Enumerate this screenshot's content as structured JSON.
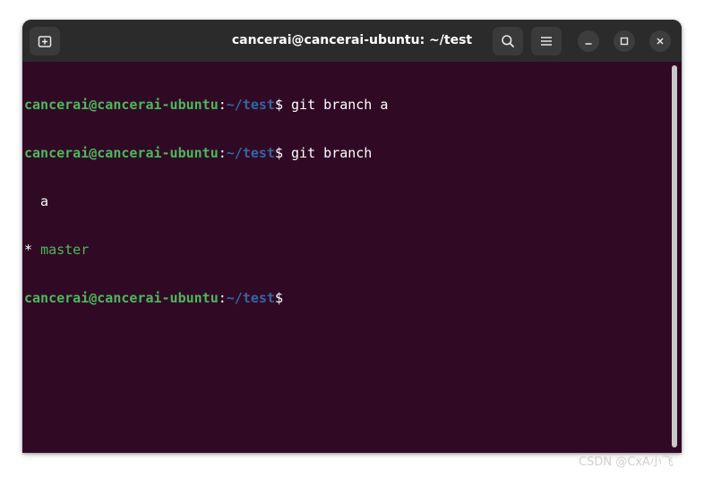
{
  "window": {
    "title": "cancerai@cancerai-ubuntu: ~/test"
  },
  "toolbar": {
    "new_tab_icon": "new-tab-icon",
    "search_icon": "search-icon",
    "menu_icon": "hamburger-menu-icon",
    "minimize_icon": "minimize-icon",
    "maximize_icon": "maximize-icon",
    "close_icon": "close-icon"
  },
  "terminal": {
    "prompt": {
      "user_host": "cancerai@cancerai-ubuntu",
      "colon": ":",
      "path": "~/test",
      "symbol": "$"
    },
    "commands": [
      " git branch a",
      " git branch",
      ""
    ],
    "output": {
      "branch_a": "  a",
      "current_marker": "* ",
      "current_branch": "master"
    }
  },
  "watermark": "CSDN @CxA小飞",
  "colors": {
    "terminal_bg": "#300a24",
    "titlebar_bg": "#2b2b2b",
    "prompt_user": "#4bb85c",
    "prompt_path": "#3465a4"
  }
}
